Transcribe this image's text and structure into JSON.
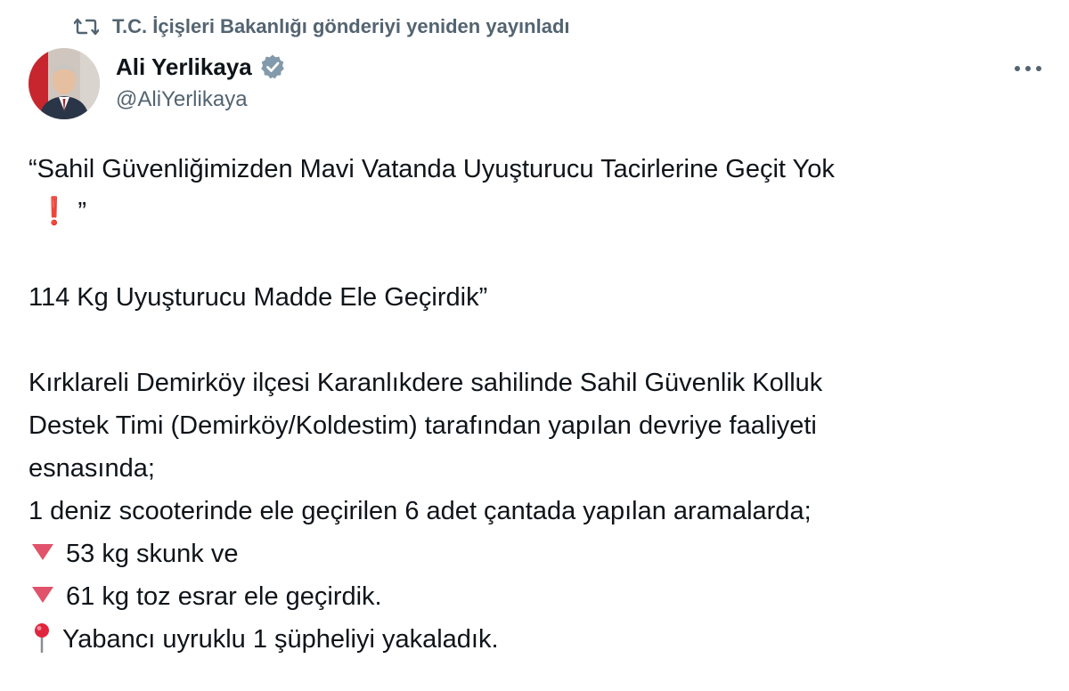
{
  "repost": {
    "text": "T.C. İçişleri Bakanlığı gönderiyi yeniden yayınladı",
    "icon": "repost-icon"
  },
  "author": {
    "display_name": "Ali Yerlikaya",
    "handle": "@AliYerlikaya",
    "verified": true,
    "verified_color": "#829aab"
  },
  "tweet": {
    "line1": "“Sahil Güvenliğimizden Mavi Vatanda Uyuşturucu Tacirlerine Geçit Yok",
    "line2_exclaim": "❗",
    "line2_quote": "”",
    "line3": "114 Kg Uyuşturucu Madde Ele Geçirdik”",
    "line4": "Kırklareli Demirköy ilçesi Karanlıkdere sahilinde Sahil Güvenlik Kolluk",
    "line5": "Destek Timi (Demirköy/Koldestim) tarafından yapılan devriye faaliyeti",
    "line6": "esnasında;",
    "line7": "1 deniz scooterinde ele geçirilen 6 adet çantada yapılan aramalarda;",
    "item1": "53 kg skunk ve",
    "item2": "61 kg toz esrar ele geçirdik.",
    "item3": "Yabancı uyruklu 1 şüpheliyi yakaladık."
  },
  "colors": {
    "text": "#0f1419",
    "secondary": "#536471",
    "exclaim": "#e0173a",
    "triangle": "#e0536a"
  }
}
